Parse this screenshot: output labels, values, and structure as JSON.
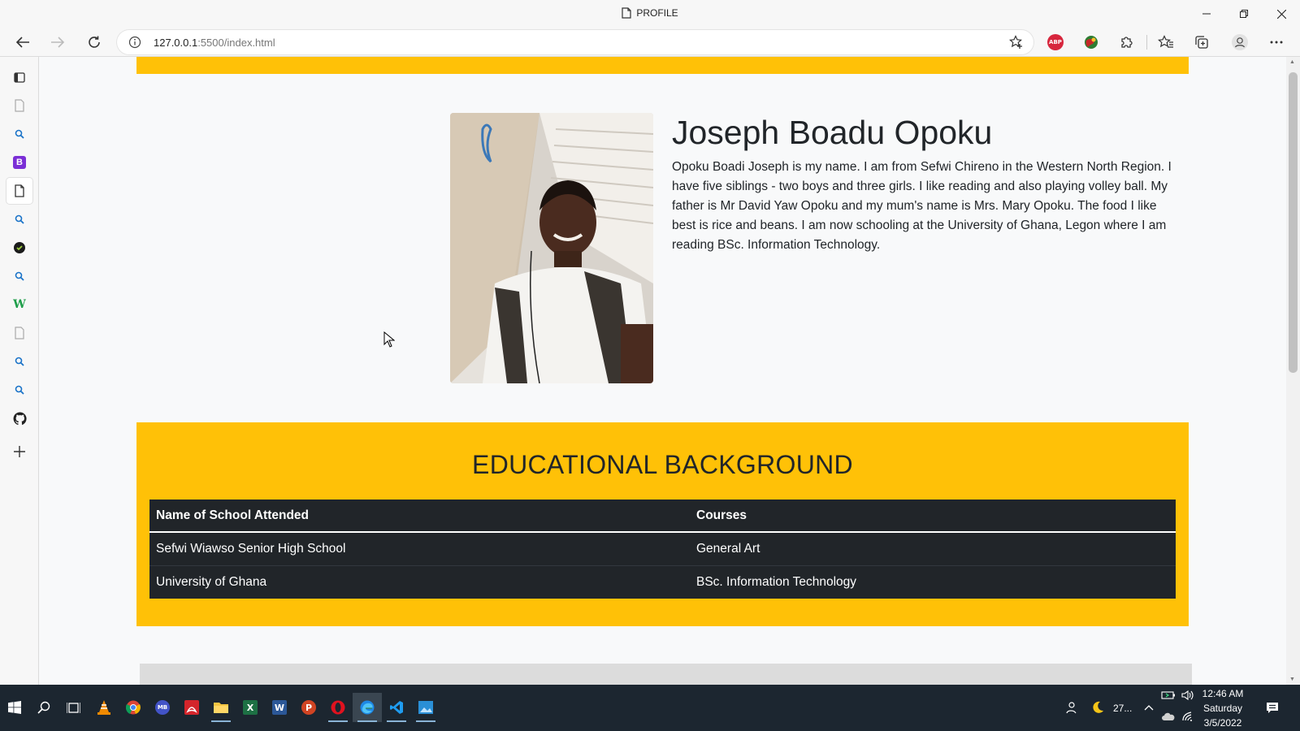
{
  "window": {
    "title": "PROFILE"
  },
  "browser": {
    "url_host": "127.0.0.1",
    "url_path": ":5500/index.html",
    "extensions": [
      "abp-icon",
      "globe-extension-icon",
      "puzzle-icon"
    ],
    "abp_label": "ABP"
  },
  "sidebar": {
    "items": [
      "tabs-icon",
      "page-icon",
      "search-icon",
      "bootstrap-icon",
      "page-icon",
      "search-icon",
      "circle-app-icon",
      "search-icon",
      "w-app-icon",
      "page-icon",
      "search-icon",
      "search-icon",
      "github-icon",
      "add-icon"
    ],
    "b_label": "B",
    "w_label": "W"
  },
  "profile": {
    "name": "Joseph Boadu Opoku",
    "bio": "Opoku Boadi Joseph is my name. I am from Sefwi Chireno in the Western North Region. I have five siblings - two boys and three girls. I like reading and also playing volley ball. My father is Mr David Yaw Opoku and my mum's name is Mrs. Mary Opoku. The food I like best is rice and beans. I am now schooling at the University of Ghana, Legon where I am reading BSc. Information Technology."
  },
  "education": {
    "title": "EDUCATIONAL BACKGROUND",
    "headers": [
      "Name of School Attended",
      "Courses"
    ],
    "rows": [
      [
        "Sefwi Wiawso Senior High School",
        "General Art"
      ],
      [
        "University of Ghana",
        "BSc. Information Technology"
      ]
    ]
  },
  "colors": {
    "accent": "#ffc107",
    "table_bg": "#212529",
    "page_bg": "#f8f9fa"
  },
  "taskbar": {
    "apps": [
      "vlc-icon",
      "chrome-icon",
      "mb-icon",
      "acrobat-icon",
      "file-explorer-icon",
      "excel-icon",
      "word-icon",
      "powerpoint-icon",
      "opera-icon",
      "edge-icon",
      "vscode-icon",
      "photos-icon"
    ],
    "mb_label": "MB",
    "x_label": "X",
    "w_label": "W",
    "p_label": "P",
    "weather": "27...",
    "time": "12:46 AM",
    "day": "Saturday",
    "date": "3/5/2022"
  }
}
